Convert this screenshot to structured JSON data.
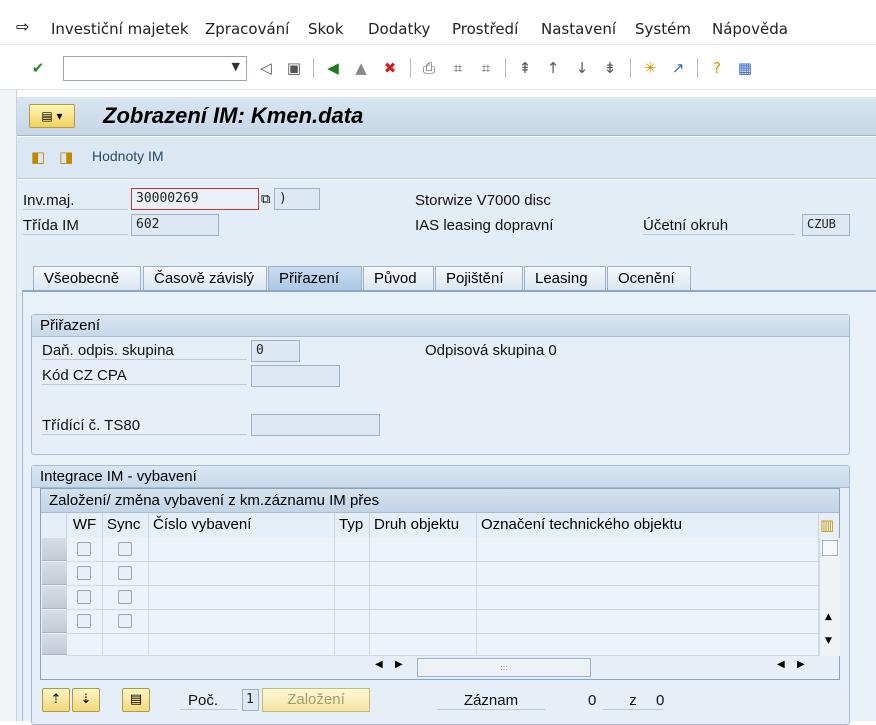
{
  "menubar": {
    "items": [
      "Investiční majetek",
      "Zpracování",
      "Skok",
      "Dodatky",
      "Prostředí",
      "Nastavení",
      "Systém",
      "Nápověda"
    ]
  },
  "toolbar": {
    "command_value": ""
  },
  "title": "Zobrazení IM:  Kmen.data",
  "app_toolbar": {
    "values_button": "Hodnoty IM"
  },
  "header": {
    "asset_label": "Inv.maj.",
    "asset_value": "30000269",
    "asset_sub_value": ")",
    "description": "Storwize V7000 disc",
    "class_label": "Třída IM",
    "class_value": "602",
    "class_description": "IAS leasing dopravní",
    "company_label": "Účetní okruh",
    "company_value": "CZUB"
  },
  "tabs": [
    {
      "label": "Všeobecně"
    },
    {
      "label": "Časově závislý"
    },
    {
      "label": "Přiřazení",
      "active": true
    },
    {
      "label": "Původ"
    },
    {
      "label": "Pojištění"
    },
    {
      "label": "Leasing"
    },
    {
      "label": "Ocenění"
    }
  ],
  "assignment": {
    "title": "Přiřazení",
    "tax_group_label": "Daň. odpis. skupina",
    "tax_group_value": "0",
    "tax_group_text": "Odpisová skupina 0",
    "cpa_label": "Kód CZ CPA",
    "cpa_value": "",
    "ts80_label": "Třídící č. TS80",
    "ts80_value": ""
  },
  "integration": {
    "title": "Integrace IM - vybavení",
    "table_title": "Založení/ změna vybavení z km.záznamu IM přes",
    "columns": [
      "WF",
      "Sync",
      "Číslo vybavení",
      "Typ",
      "Druh objektu",
      "Označení technického objektu"
    ],
    "rows": 4,
    "count_label": "Poč.",
    "count_value": "1",
    "create_button": "Založení",
    "record_label": "Záznam",
    "record_current": "0",
    "record_of": "z",
    "record_total": "0"
  }
}
